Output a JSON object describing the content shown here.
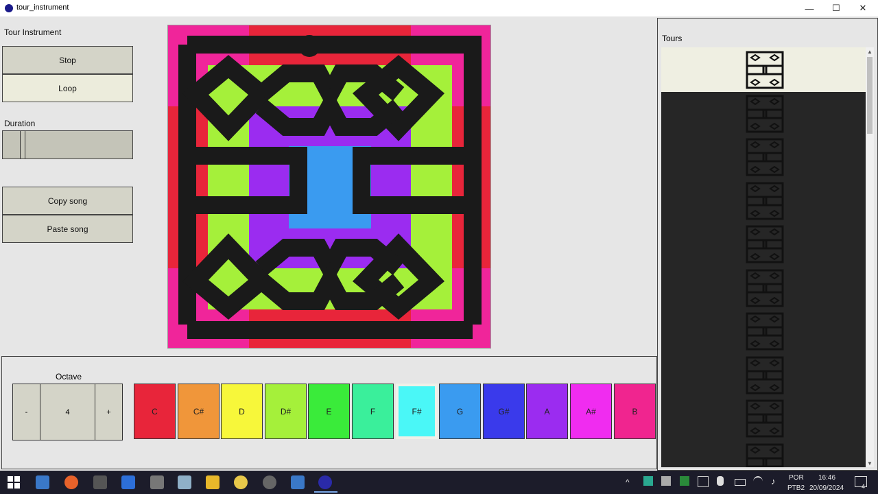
{
  "window": {
    "title": "tour_instrument",
    "controls": [
      "—",
      "☐",
      "✕"
    ]
  },
  "left": {
    "app_label": "Tour Instrument",
    "stop_label": "Stop",
    "loop_label": "Loop",
    "duration_label": "Duration",
    "duration_value": 0.13,
    "copy_label": "Copy song",
    "paste_label": "Paste song"
  },
  "tours": {
    "title": "Tours",
    "count": 10,
    "selected_index": 0
  },
  "octave": {
    "label": "Octave",
    "minus": "-",
    "value": "4",
    "plus": "+"
  },
  "notes": [
    {
      "name": "C",
      "color": "#e8253a"
    },
    {
      "name": "C#",
      "color": "#f0963a"
    },
    {
      "name": "D",
      "color": "#f7f73a"
    },
    {
      "name": "D#",
      "color": "#a5f03a"
    },
    {
      "name": "E",
      "color": "#3aeb3a"
    },
    {
      "name": "F",
      "color": "#3aef9b"
    },
    {
      "name": "F#",
      "color": "#4af7f7"
    },
    {
      "name": "G",
      "color": "#3a9bf0"
    },
    {
      "name": "G#",
      "color": "#3a3aeb"
    },
    {
      "name": "A",
      "color": "#9b2cf0"
    },
    {
      "name": "A#",
      "color": "#f02cf0"
    },
    {
      "name": "B",
      "color": "#f0258f"
    }
  ],
  "selected_note": "F#",
  "taskbar": {
    "lang1": "POR",
    "lang2": "PTB2",
    "time": "16:46",
    "date": "20/09/2024",
    "notif": "4"
  }
}
